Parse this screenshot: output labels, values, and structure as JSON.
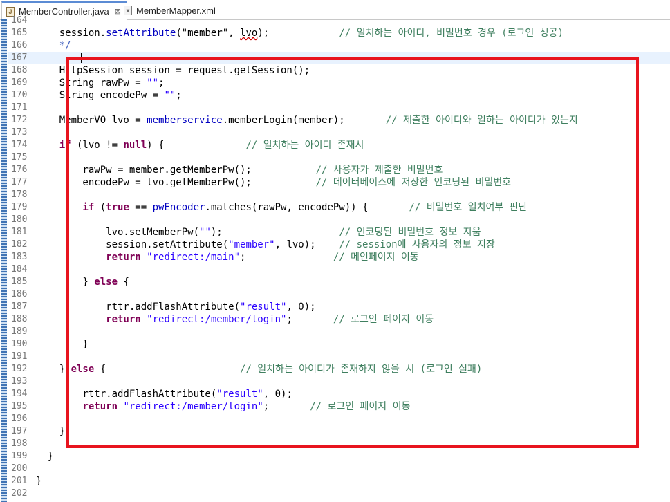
{
  "tabs": [
    {
      "label": "MemberController.java",
      "close": "⊠",
      "active": true,
      "icon": "java-file-icon"
    },
    {
      "label": "MemberMapper.xml",
      "active": false,
      "icon": "xml-file-icon"
    }
  ],
  "lines": [
    {
      "n": "164",
      "segs": []
    },
    {
      "n": "165",
      "segs": [
        [
          "",
          "    session."
        ],
        [
          "fld",
          "setAttribute"
        ],
        [
          "",
          "(\"member\", "
        ],
        [
          "sq",
          "lvo"
        ],
        [
          "",
          ");            "
        ],
        [
          "cm2",
          "// 일치하는 아이디, 비밀번호 경우 (로그인 성공)"
        ]
      ]
    },
    {
      "n": "166",
      "segs": [
        [
          "cm",
          "    */"
        ]
      ]
    },
    {
      "n": "167",
      "segs": [],
      "current": true
    },
    {
      "n": "168",
      "segs": [
        [
          "",
          "    HttpSession session = request.getSession();"
        ]
      ]
    },
    {
      "n": "169",
      "segs": [
        [
          "",
          "    String rawPw = "
        ],
        [
          "str",
          "\"\""
        ],
        [
          "",
          ";"
        ]
      ]
    },
    {
      "n": "170",
      "segs": [
        [
          "",
          "    String encodePw = "
        ],
        [
          "str",
          "\"\""
        ],
        [
          "",
          ";"
        ]
      ]
    },
    {
      "n": "171",
      "segs": []
    },
    {
      "n": "172",
      "segs": [
        [
          "",
          "    MemberVO lvo = "
        ],
        [
          "fld",
          "memberservice"
        ],
        [
          "",
          ".memberLogin(member);       "
        ],
        [
          "cm2",
          "// 제출한 아이디와 일하는 아이디가 있는지"
        ]
      ]
    },
    {
      "n": "173",
      "segs": []
    },
    {
      "n": "174",
      "segs": [
        [
          "kw",
          "    if"
        ],
        [
          "",
          " (lvo != "
        ],
        [
          "kw",
          "null"
        ],
        [
          "",
          ") {              "
        ],
        [
          "cm2",
          "// 일치하는 아이디 존재시"
        ]
      ]
    },
    {
      "n": "175",
      "segs": []
    },
    {
      "n": "176",
      "segs": [
        [
          "",
          "        rawPw = member.getMemberPw();           "
        ],
        [
          "cm2",
          "// 사용자가 제출한 비밀번호"
        ]
      ]
    },
    {
      "n": "177",
      "segs": [
        [
          "",
          "        encodePw = lvo.getMemberPw();           "
        ],
        [
          "cm2",
          "// 데이터베이스에 저장한 인코딩된 비밀번호"
        ]
      ]
    },
    {
      "n": "178",
      "segs": []
    },
    {
      "n": "179",
      "segs": [
        [
          "kw",
          "        if"
        ],
        [
          "",
          " ("
        ],
        [
          "kw",
          "true"
        ],
        [
          "",
          " == "
        ],
        [
          "fld",
          "pwEncoder"
        ],
        [
          "",
          ".matches(rawPw, encodePw)) {       "
        ],
        [
          "cm2",
          "// 비밀번호 일치여부 판단"
        ]
      ]
    },
    {
      "n": "180",
      "segs": []
    },
    {
      "n": "181",
      "segs": [
        [
          "",
          "            lvo.setMemberPw("
        ],
        [
          "str",
          "\"\""
        ],
        [
          "",
          ");                    "
        ],
        [
          "cm2",
          "// 인코딩된 비밀번호 정보 지움"
        ]
      ]
    },
    {
      "n": "182",
      "segs": [
        [
          "",
          "            session.setAttribute("
        ],
        [
          "str",
          "\"member\""
        ],
        [
          "",
          ", lvo);    "
        ],
        [
          "cm2",
          "// session에 사용자의 정보 저장"
        ]
      ]
    },
    {
      "n": "183",
      "segs": [
        [
          "kw",
          "            return"
        ],
        [
          "",
          " "
        ],
        [
          "str",
          "\"redirect:/main\""
        ],
        [
          "",
          ";               "
        ],
        [
          "cm2",
          "// 메인페이지 이동"
        ]
      ]
    },
    {
      "n": "184",
      "segs": []
    },
    {
      "n": "185",
      "segs": [
        [
          "",
          "        } "
        ],
        [
          "kw",
          "else"
        ],
        [
          "",
          " {"
        ]
      ]
    },
    {
      "n": "186",
      "segs": []
    },
    {
      "n": "187",
      "segs": [
        [
          "",
          "            rttr.addFlashAttribute("
        ],
        [
          "str",
          "\"result\""
        ],
        [
          "",
          ", 0);"
        ]
      ]
    },
    {
      "n": "188",
      "segs": [
        [
          "kw",
          "            return"
        ],
        [
          "",
          " "
        ],
        [
          "str",
          "\"redirect:/member/login\""
        ],
        [
          "",
          ";       "
        ],
        [
          "cm2",
          "// 로그인 페이지 이동"
        ]
      ]
    },
    {
      "n": "189",
      "segs": []
    },
    {
      "n": "190",
      "segs": [
        [
          "",
          "        }"
        ]
      ]
    },
    {
      "n": "191",
      "segs": []
    },
    {
      "n": "192",
      "segs": [
        [
          "",
          "    } "
        ],
        [
          "kw",
          "else"
        ],
        [
          "",
          " {                       "
        ],
        [
          "cm2",
          "// 일치하는 아이디가 존재하지 않을 시 (로그인 실패)"
        ]
      ]
    },
    {
      "n": "193",
      "segs": []
    },
    {
      "n": "194",
      "segs": [
        [
          "",
          "        rttr.addFlashAttribute("
        ],
        [
          "str",
          "\"result\""
        ],
        [
          "",
          ", 0);"
        ]
      ]
    },
    {
      "n": "195",
      "segs": [
        [
          "kw",
          "        return"
        ],
        [
          "",
          " "
        ],
        [
          "str",
          "\"redirect:/member/login\""
        ],
        [
          "",
          ";       "
        ],
        [
          "cm2",
          "// 로그인 페이지 이동"
        ]
      ]
    },
    {
      "n": "196",
      "segs": []
    },
    {
      "n": "197",
      "segs": [
        [
          "",
          "    }"
        ]
      ]
    },
    {
      "n": "198",
      "segs": []
    },
    {
      "n": "199",
      "segs": [
        [
          "",
          "  }"
        ]
      ]
    },
    {
      "n": "200",
      "segs": []
    },
    {
      "n": "201",
      "segs": [
        [
          "",
          "}"
        ]
      ]
    },
    {
      "n": "202",
      "segs": []
    }
  ],
  "colors": {
    "keyword": "#7f0055",
    "string": "#2a00ff",
    "field": "#0000c0",
    "comment": "#3f7f5f",
    "highlight_box": "#e8141e"
  }
}
